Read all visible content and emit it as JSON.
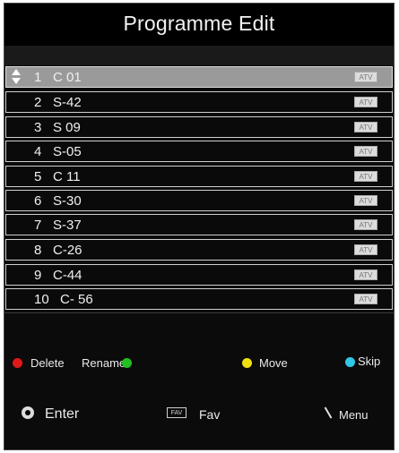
{
  "title": "Programme Edit",
  "channels": [
    {
      "num": "1",
      "name": "C  01",
      "type": "ATV",
      "selected": true
    },
    {
      "num": "2",
      "name": "S-42",
      "type": "ATV",
      "selected": false
    },
    {
      "num": "3",
      "name": "S  09",
      "type": "ATV",
      "selected": false
    },
    {
      "num": "4",
      "name": "S-05",
      "type": "ATV",
      "selected": false
    },
    {
      "num": "5",
      "name": "C  11",
      "type": "ATV",
      "selected": false
    },
    {
      "num": "6",
      "name": "S-30",
      "type": "ATV",
      "selected": false
    },
    {
      "num": "7",
      "name": "S-37",
      "type": "ATV",
      "selected": false
    },
    {
      "num": "8",
      "name": "C-26",
      "type": "ATV",
      "selected": false
    },
    {
      "num": "9",
      "name": "C-44",
      "type": "ATV",
      "selected": false
    },
    {
      "num": "10",
      "name": "C-  56",
      "type": "ATV",
      "selected": false
    }
  ],
  "keys": {
    "delete": {
      "label": "Delete",
      "color": "#e01818"
    },
    "rename": {
      "label": "Rename",
      "color": "#22c022"
    },
    "move": {
      "label": "Move",
      "color": "#f0e010"
    },
    "skip": {
      "label": "Skip",
      "color": "#30c8e8"
    }
  },
  "footer": {
    "enter_label": "Enter",
    "fav_icon_text": "FAV",
    "fav_label": "Fav",
    "menu_label": "Menu"
  }
}
